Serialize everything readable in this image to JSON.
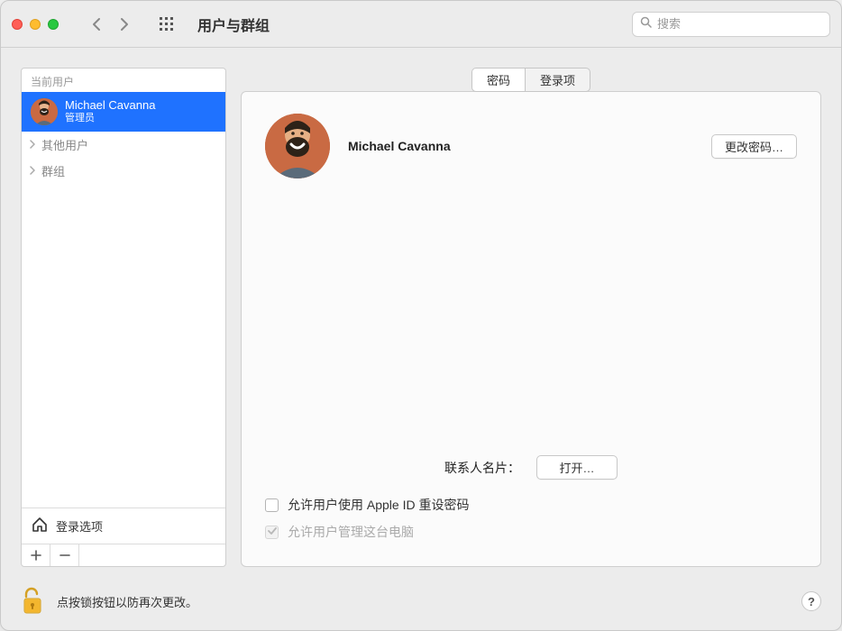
{
  "window_title": "用户与群组",
  "search": {
    "placeholder": "搜索"
  },
  "sidebar": {
    "current_user_header": "当前用户",
    "current_user": {
      "name": "Michael Cavanna",
      "role": "管理员"
    },
    "items": [
      {
        "label": "其他用户"
      },
      {
        "label": "群组"
      }
    ],
    "login_options_label": "登录选项"
  },
  "tabs": {
    "password": "密码",
    "login_items": "登录项",
    "active": "password"
  },
  "panel": {
    "user_name": "Michael Cavanna",
    "change_password_btn": "更改密码…",
    "contact_card_label": "联系人名片：",
    "open_btn": "打开…",
    "allow_reset_with_apple_id": "允许用户使用 Apple ID 重设密码",
    "allow_admin": "允许用户管理这台电脑"
  },
  "footer": {
    "lock_text": "点按锁按钮以防再次更改。"
  },
  "icons": {
    "help": "?"
  }
}
